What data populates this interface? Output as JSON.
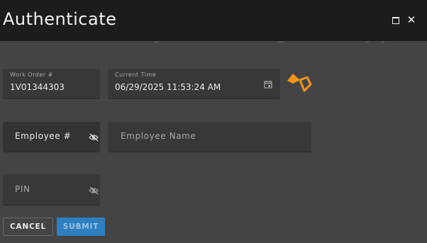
{
  "window": {
    "title": "Authenticate"
  },
  "icons": {
    "maximize": "maximize-icon",
    "close": "close-icon",
    "calendar": "calendar-icon",
    "visibility_off": "eye-off-icon",
    "barcode_scanner": "orange-scanner-icon"
  },
  "form": {
    "work_order": {
      "label": "Work Order #",
      "value": "1V01344303"
    },
    "current_time": {
      "label": "Current Time",
      "value": "06/29/2025 11:53:24 AM"
    },
    "employee_number": {
      "placeholder": "Employee #"
    },
    "employee_name": {
      "placeholder": "Employee Name"
    },
    "pin": {
      "placeholder": "PIN"
    }
  },
  "buttons": {
    "cancel": "CANCEL",
    "submit": "SUBMIT"
  },
  "colors": {
    "titlebar": "#1c1c1c",
    "background": "#444444",
    "field": "#383838",
    "accent_orange": "#f7941d",
    "submit": "#2f7fbf"
  }
}
